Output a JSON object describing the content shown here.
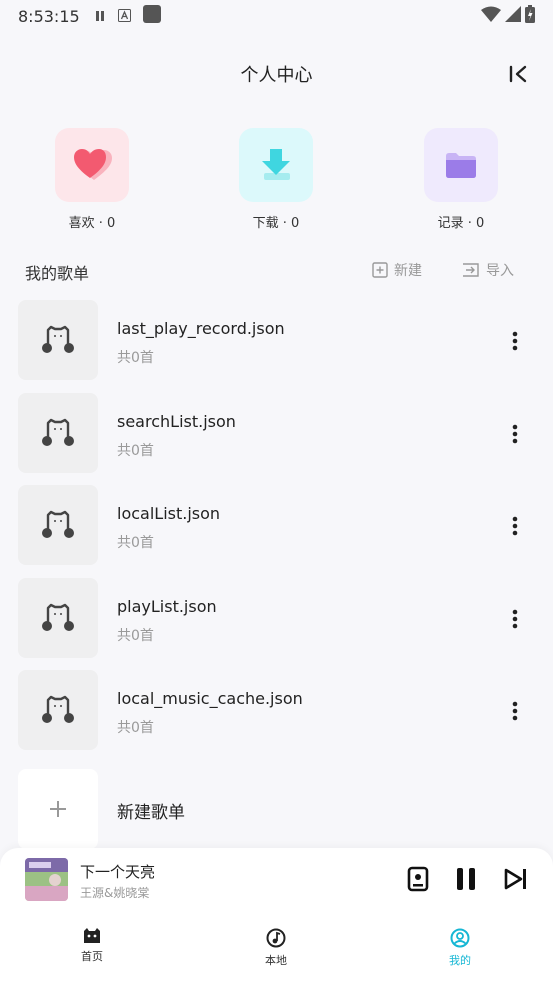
{
  "status": {
    "time": "8:53:15"
  },
  "header": {
    "title": "个人中心"
  },
  "quick": [
    {
      "label": "喜欢 · 0",
      "icon": "heart-icon",
      "bg": "#fde6ea",
      "color": "#f35a70"
    },
    {
      "label": "下载 · 0",
      "icon": "download-icon",
      "bg": "#dcf9fb",
      "color": "#3fd6e0"
    },
    {
      "label": "记录 · 0",
      "icon": "folder-icon",
      "bg": "#efeafd",
      "color": "#9b7ce8"
    }
  ],
  "section": {
    "title": "我的歌单",
    "new_label": "新建",
    "import_label": "导入"
  },
  "playlists": [
    {
      "name": "last_play_record.json",
      "count": "共0首"
    },
    {
      "name": "searchList.json",
      "count": "共0首"
    },
    {
      "name": "localList.json",
      "count": "共0首"
    },
    {
      "name": "playList.json",
      "count": "共0首"
    },
    {
      "name": "local_music_cache.json",
      "count": "共0首"
    }
  ],
  "new_playlist": {
    "label": "新建歌单"
  },
  "player": {
    "title": "下一个天亮",
    "artist": "王源&姚晓棠"
  },
  "tabs": [
    {
      "label": "首页",
      "icon": "cat-icon",
      "active": false
    },
    {
      "label": "本地",
      "icon": "music-disc-icon",
      "active": false
    },
    {
      "label": "我的",
      "icon": "user-circle-icon",
      "active": true
    }
  ],
  "colors": {
    "accent": "#16b7d4"
  }
}
